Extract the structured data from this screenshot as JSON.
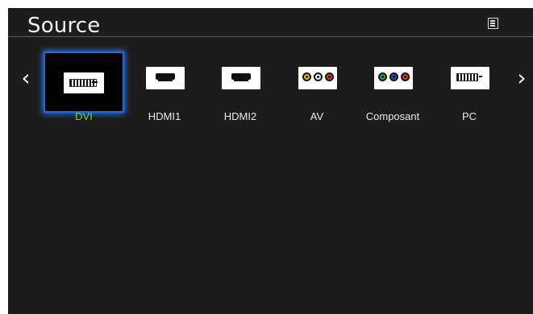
{
  "header": {
    "title": "Source"
  },
  "navigation": {
    "left_arrow": "‹",
    "right_arrow": "›"
  },
  "sources": [
    {
      "label": "DVI",
      "icon": "dvi-port-icon",
      "selected": true
    },
    {
      "label": "HDMI1",
      "icon": "hdmi-port-icon",
      "selected": false
    },
    {
      "label": "HDMI2",
      "icon": "hdmi-port-icon",
      "selected": false
    },
    {
      "label": "AV",
      "icon": "av-port-icon",
      "selected": false
    },
    {
      "label": "Composant",
      "icon": "component-port-icon",
      "selected": false
    },
    {
      "label": "PC",
      "icon": "pc-port-icon",
      "selected": false
    }
  ],
  "colors": {
    "panel_background": "#1c1c1c",
    "selected_label": "#8dc63f",
    "selection_glow": "#2a7dff",
    "av_yellow": "#f2c300",
    "av_white": "#f2f2f2",
    "av_red": "#e3342f",
    "component_green": "#2fa04a",
    "component_blue": "#2e4fb8",
    "component_red": "#e3342f"
  }
}
